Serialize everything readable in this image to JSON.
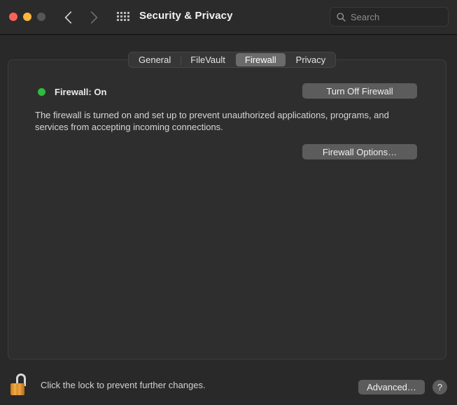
{
  "window": {
    "title": "Security & Privacy",
    "traffic_lights": [
      {
        "name": "close",
        "color": "#f9625b"
      },
      {
        "name": "minimize",
        "color": "#fbb63f"
      },
      {
        "name": "maximize",
        "color": "#575757"
      }
    ],
    "back_icon": "chevron-left-icon",
    "forward_icon": "chevron-right-icon",
    "grid_icon": "show-all-grid-icon"
  },
  "search": {
    "icon": "search-icon",
    "placeholder": "Search",
    "value": ""
  },
  "tabs": [
    {
      "label": "General",
      "selected": false
    },
    {
      "label": "FileVault",
      "selected": false
    },
    {
      "label": "Firewall",
      "selected": true
    },
    {
      "label": "Privacy",
      "selected": false
    }
  ],
  "firewall": {
    "status_dot_color": "#2ebd3f",
    "status_label": "Firewall: On",
    "description": "The firewall is turned on and set up to prevent unauthorized applications, programs, and services from accepting incoming connections.",
    "turn_off_button": "Turn Off Firewall",
    "options_button": "Firewall Options…"
  },
  "footer": {
    "lock_icon": "unlocked-padlock-icon",
    "lock_state": "unlocked",
    "lock_message": "Click the lock to prevent further changes.",
    "advanced_button": "Advanced…",
    "help_button": "?"
  }
}
